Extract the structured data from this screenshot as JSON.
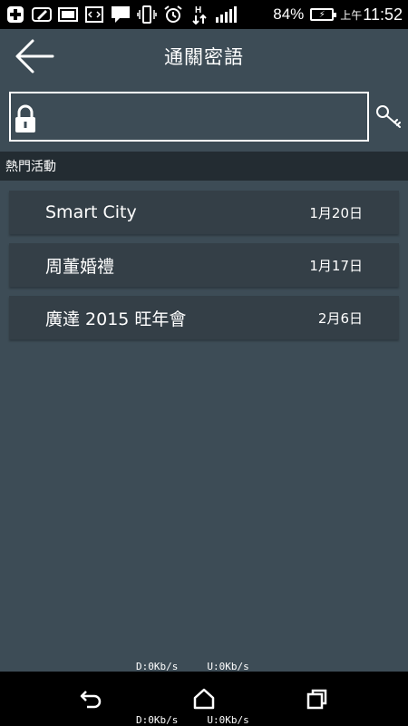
{
  "status_bar": {
    "battery_percent": "84%",
    "time_prefix": "上午",
    "time": "11:52",
    "icons": [
      "plus-icon",
      "edit-icon",
      "image-icon",
      "code-icon",
      "chat-icon",
      "vibrate-icon",
      "alarm-icon",
      "h-data-icon",
      "signal-icon",
      "battery-icon"
    ]
  },
  "header": {
    "title": "通關密語"
  },
  "password": {
    "value": "",
    "placeholder": ""
  },
  "section": {
    "title": "熱門活動"
  },
  "events": [
    {
      "name": "Smart City",
      "date": "1月20日"
    },
    {
      "name": "周董婚禮",
      "date": "1月17日"
    },
    {
      "name": "廣達 2015 旺年會",
      "date": "2月6日"
    }
  ],
  "network_speed": {
    "download": "D:0Kb/s",
    "upload": "U:0Kb/s"
  },
  "nav": {
    "icons": [
      "back-nav-icon",
      "home-nav-icon",
      "recent-apps-icon"
    ]
  }
}
